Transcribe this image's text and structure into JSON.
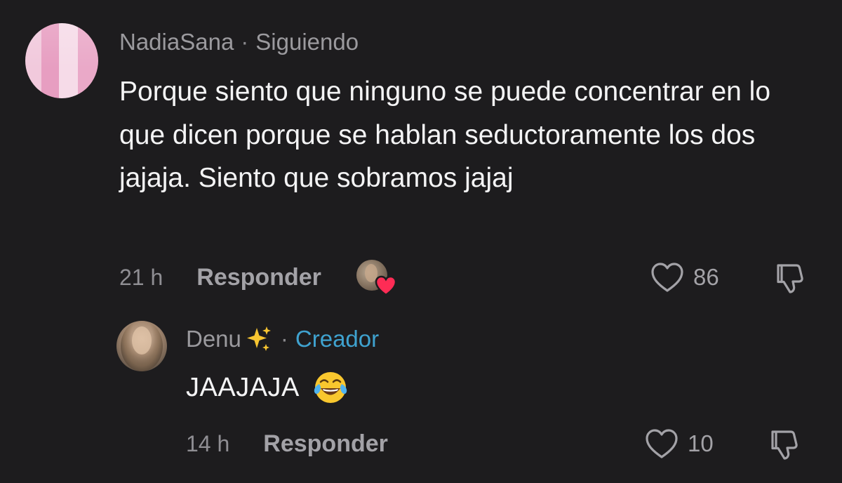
{
  "parent_comment": {
    "username": "NadiaSana",
    "separator": "·",
    "relationship": "Siguiendo",
    "text": "Porque siento que ninguno se puede concentrar en lo que dicen porque se hablan seductoramente los dos jajaja. Siento que sobramos jajaj",
    "time": "21 h",
    "reply_label": "Responder",
    "like_count": "86",
    "liked_by_creator": true
  },
  "reply_comment": {
    "username": "Denu",
    "username_emoji": "sparkles",
    "separator": "·",
    "badge": "Creador",
    "text": "JAAJAJA",
    "text_emoji": "face-with-tears-of-joy",
    "time": "14 h",
    "reply_label": "Responder",
    "like_count": "10"
  },
  "icons": {
    "like": "heart-outline-icon",
    "dislike": "thumbs-down-outline-icon",
    "creator_heart": "red-heart-icon"
  },
  "colors": {
    "background": "#1d1c1e",
    "primary_text": "#f4f4f5",
    "secondary_text": "#9b9a9e",
    "creator_badge": "#3fa2cf",
    "heart_red": "#fe2c55"
  }
}
